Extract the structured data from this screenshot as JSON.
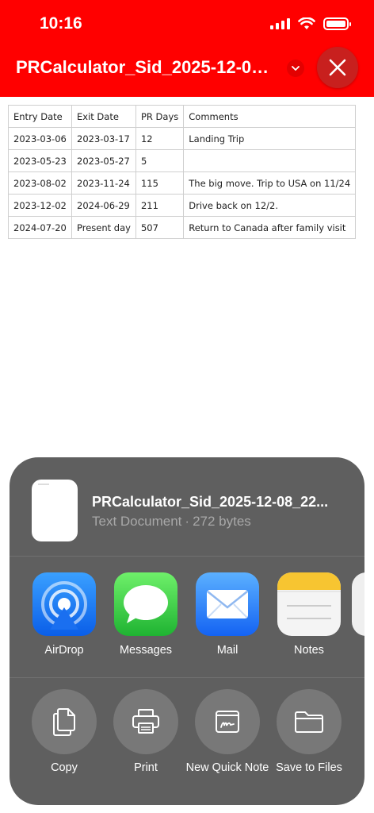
{
  "status_bar": {
    "time": "10:16"
  },
  "header": {
    "title": "PRCalculator_Sid_2025-12-08_..."
  },
  "table": {
    "columns": [
      "Entry Date",
      "Exit Date",
      "PR Days",
      "Comments"
    ],
    "rows": [
      [
        "2023-03-06",
        "2023-03-17",
        "12",
        "Landing Trip"
      ],
      [
        "2023-05-23",
        "2023-05-27",
        "5",
        ""
      ],
      [
        "2023-08-02",
        "2023-11-24",
        "115",
        "The big move. Trip to USA on 11/24"
      ],
      [
        "2023-12-02",
        "2024-06-29",
        "211",
        "Drive back on 12/2."
      ],
      [
        "2024-07-20",
        "Present day",
        "507",
        "Return to Canada after family visit"
      ]
    ]
  },
  "share_sheet": {
    "file_name": "PRCalculator_Sid_2025-12-08_22...",
    "file_type": "Text Document",
    "file_size": "272 bytes",
    "apps": [
      {
        "label": "AirDrop",
        "icon": "airdrop-icon"
      },
      {
        "label": "Messages",
        "icon": "messages-icon"
      },
      {
        "label": "Mail",
        "icon": "mail-icon"
      },
      {
        "label": "Notes",
        "icon": "notes-icon"
      }
    ],
    "actions": [
      {
        "label": "Copy",
        "icon": "copy-icon"
      },
      {
        "label": "Print",
        "icon": "print-icon"
      },
      {
        "label": "New Quick Note",
        "icon": "quick-note-icon"
      },
      {
        "label": "Save to Files",
        "icon": "folder-icon"
      }
    ]
  },
  "colors": {
    "header": "#ff0000",
    "sheet": "#5f5f5f",
    "close_button": "#c8201e"
  }
}
